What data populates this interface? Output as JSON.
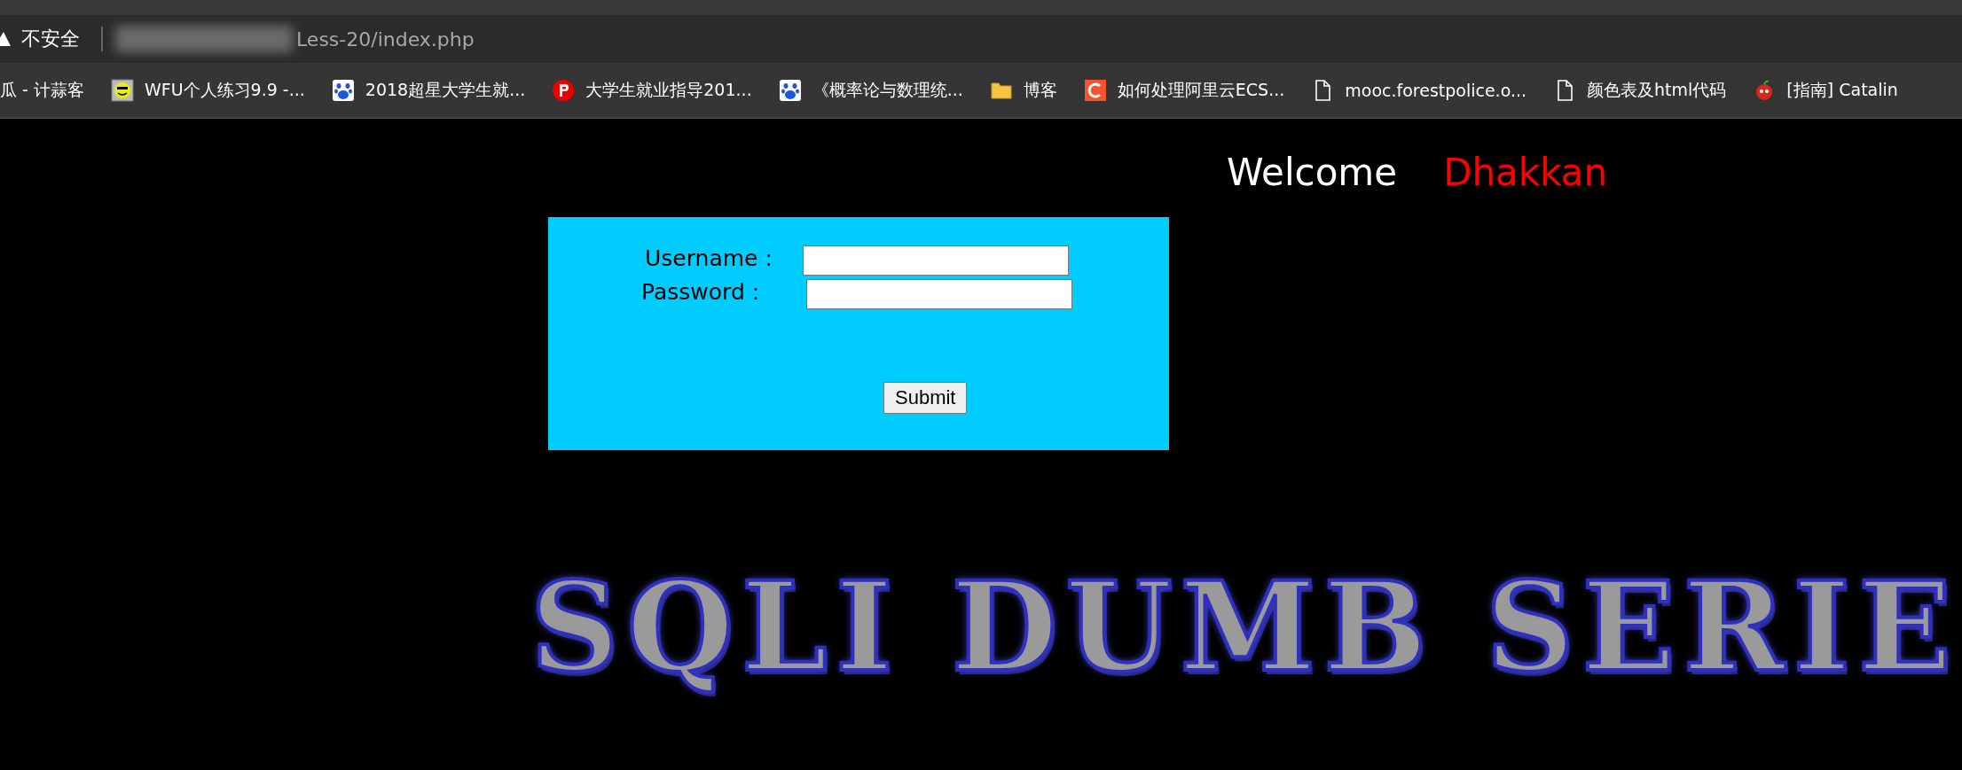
{
  "address_bar": {
    "security_label": "不安全",
    "url": "Less-20/index.php"
  },
  "bookmarks": [
    {
      "kind": "none",
      "label": "瓜 - 计蒜客"
    },
    {
      "kind": "smiley",
      "label": "WFU个人练习9.9 -..."
    },
    {
      "kind": "paw",
      "label": "2018超星大学生就..."
    },
    {
      "kind": "p",
      "label": "大学生就业指导201..."
    },
    {
      "kind": "paw",
      "label": "《概率论与数理统..."
    },
    {
      "kind": "folder",
      "label": "博客"
    },
    {
      "kind": "c",
      "label": "如何处理阿里云ECS..."
    },
    {
      "kind": "doc",
      "label": "mooc.forestpolice.o..."
    },
    {
      "kind": "doc",
      "label": "颜色表及html代码"
    },
    {
      "kind": "apple",
      "label": "[指南] Catalin"
    }
  ],
  "greeting": {
    "welcome": "Welcome",
    "name": "Dhakkan"
  },
  "login_form": {
    "username_label": "Username :",
    "password_label": "Password :",
    "submit": "Submit"
  },
  "banner": {
    "text": "SQLI DUMB SERIE"
  }
}
